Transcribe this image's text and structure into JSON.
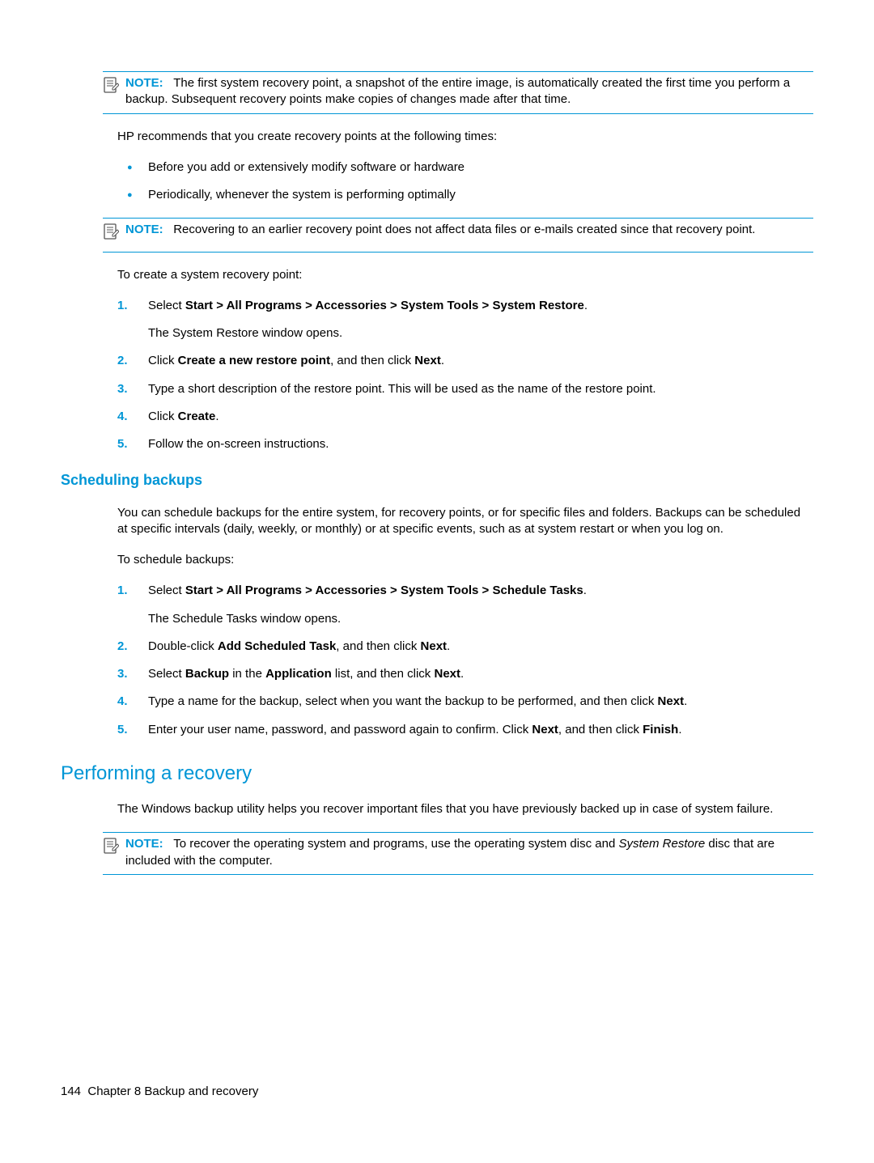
{
  "notes": {
    "n1": {
      "label": "NOTE:",
      "text": "The first system recovery point, a snapshot of the entire image, is automatically created the first time you perform a backup. Subsequent recovery points make copies of changes made after that time."
    },
    "n2": {
      "label": "NOTE:",
      "text": "Recovering to an earlier recovery point does not affect data files or e-mails created since that recovery point."
    },
    "n3": {
      "label": "NOTE:",
      "pre": "To recover the operating system and programs, use the operating system disc and ",
      "em": "System Restore",
      "post": " disc that are included with the computer."
    }
  },
  "intro": {
    "recommend": "HP recommends that you create recovery points at the following times:",
    "bullets": [
      "Before you add or extensively modify software or hardware",
      "Periodically, whenever the system is performing optimally"
    ],
    "toCreate": "To create a system recovery point:"
  },
  "steps1": {
    "s1pre": "Select ",
    "s1bold": "Start > All Programs > Accessories > System Tools > System Restore",
    "s1post": ".",
    "s1sub": "The System Restore window opens.",
    "s2pre": "Click ",
    "s2bold1": "Create a new restore point",
    "s2mid": ", and then click ",
    "s2bold2": "Next",
    "s2post": ".",
    "s3": "Type a short description of the restore point. This will be used as the name of the restore point.",
    "s4pre": "Click ",
    "s4bold": "Create",
    "s4post": ".",
    "s5": "Follow the on-screen instructions."
  },
  "sched": {
    "heading": "Scheduling backups",
    "para": "You can schedule backups for the entire system, for recovery points, or for specific files and folders. Backups can be scheduled at specific intervals (daily, weekly, or monthly) or at specific events, such as at system restart or when you log on.",
    "toSchedule": "To schedule backups:",
    "s1pre": "Select ",
    "s1bold": "Start > All Programs > Accessories > System Tools > Schedule Tasks",
    "s1post": ".",
    "s1sub": "The Schedule Tasks window opens.",
    "s2pre": "Double-click ",
    "s2bold1": "Add Scheduled Task",
    "s2mid": ", and then click ",
    "s2bold2": "Next",
    "s2post": ".",
    "s3pre": "Select ",
    "s3bold1": "Backup",
    "s3mid1": " in the ",
    "s3bold2": "Application",
    "s3mid2": " list, and then click ",
    "s3bold3": "Next",
    "s3post": ".",
    "s4pre": "Type a name for the backup, select when you want the backup to be performed, and then click ",
    "s4bold": "Next",
    "s4post": ".",
    "s5pre": "Enter your user name, password, and password again to confirm. Click ",
    "s5bold1": "Next",
    "s5mid": ", and then click ",
    "s5bold2": "Finish",
    "s5post": "."
  },
  "recovery": {
    "heading": "Performing a recovery",
    "para": "The Windows backup utility helps you recover important files that you have previously backed up in case of system failure."
  },
  "footer": {
    "page": "144",
    "chapter": "Chapter 8   Backup and recovery"
  }
}
